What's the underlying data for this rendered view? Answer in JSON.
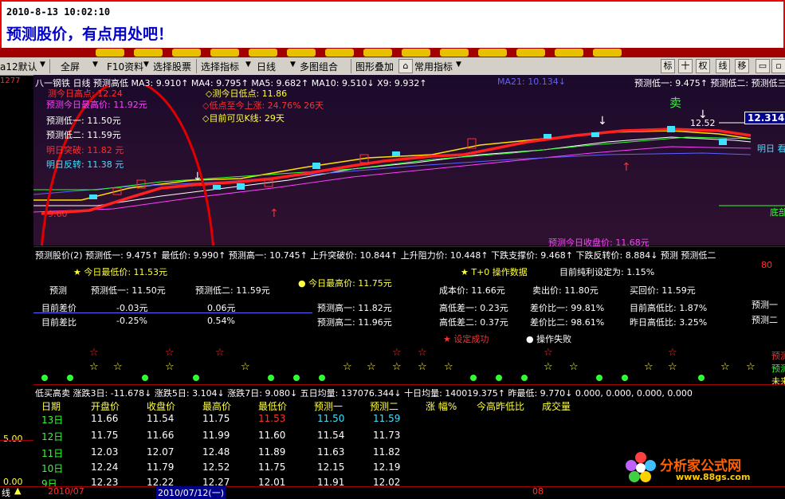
{
  "banner": {
    "timestamp": "2010-8-13 10:02:10",
    "title": "预测股价，有点用处吧！"
  },
  "toolbar": {
    "left_label": "a12默认",
    "items": [
      "全屏",
      "F10资料",
      "选择股票",
      "选择指标",
      "日线",
      "多图组合",
      "图形叠加",
      "常用指标"
    ],
    "right_icons": [
      "标",
      "十",
      "权",
      "线",
      "移"
    ]
  },
  "chart1": {
    "header": "八一钢铁 日线 预测高低 MA3: 9.910↑ MA4: 9.795↑ MA5: 9.682↑ MA10: 9.510↓ X9: 9.932↑",
    "header_ma21": "MA21: 10.134↓",
    "header_right": "预测低一: 9.475↑ 预测低二: 预测低三",
    "left_axis_top": "1277",
    "legend": [
      {
        "text": "测今日高点: 12.24",
        "color": "#ff3030"
      },
      {
        "text": "预测今日最高价: 11.92元",
        "color": "#ff40ff"
      },
      {
        "text": "预测低一: 11.50元",
        "color": "#ffffff"
      },
      {
        "text": "预测低二: 11.59元",
        "color": "#ffffff"
      },
      {
        "text": "明日突破: 11.82 元",
        "color": "#ff3030"
      },
      {
        "text": "明日反转: 11.38 元",
        "color": "#40e0ff"
      }
    ],
    "notes": [
      "◇测今日低点: 11.86",
      "◇低点至今上涨: 24.76%  26天",
      "◇目前可见K线: 29天"
    ],
    "sell_label": "卖",
    "price_marker": "12.52",
    "price_box": "12.314",
    "mingri_label": "明日 看",
    "dibu_label": "底部",
    "low_label": "9.60",
    "bottom_note": "预测今日收盘价: 11.68元"
  },
  "panel2": {
    "header": "预测股价(2) 预测低一: 9.475↑ 最低价: 9.990↑ 预测高一: 10.745↑ 上升突破价: 10.844↑ 上升阻力价: 10.448↑ 下跌支撑价: 9.468↑ 下跌反转价: 8.884↓ 预测 预测低二",
    "right_num": "80",
    "row1": [
      "★ 今日最低价: 11.53元",
      "● 今日最高价: 11.75元",
      "★ T+0 操作数据",
      "目前纯利设定为: 1.15%"
    ],
    "row2": [
      "预测",
      "预测低一: 11.50元",
      "预测低二: 11.59元",
      "成本价: 11.66元",
      "卖出价: 11.80元",
      "买回价: 11.59元"
    ],
    "row3": [
      "目前差价",
      "-0.03元",
      "0.06元",
      "预测高一: 11.82元",
      "高低差一: 0.23元",
      "差价比一: 99.81%",
      "目前高低比: 1.87%",
      "预测一"
    ],
    "row4": [
      "目前差比",
      "-0.25%",
      "0.54%",
      "预测高二: 11.96元",
      "高低差二: 0.37元",
      "差价比二: 98.61%",
      "昨日高低比: 3.25%",
      "预测二"
    ],
    "row5": [
      "★ 设定成功",
      "● 操作失败"
    ],
    "right_labels": [
      "预测",
      "预测",
      "未来"
    ],
    "status_line": "低买高卖 涨跌3日: -11.678↓ 涨跌5日: 3.104↓ 涨跌7日: 9.080↓ 五日均量: 137076.344↓ 十日均量: 140019.375↑ 昨最低: 9.770↓ 0.000, 0.000, 0.000, 0.000"
  },
  "table": {
    "headers": [
      "日期",
      "开盘价",
      "收盘价",
      "最高价",
      "最低价",
      "预测一",
      "预测二",
      "涨 幅%",
      "今高昨低比",
      "成交量"
    ],
    "rows": [
      [
        "13日",
        "11.66",
        "11.54",
        "11.75",
        "11.53",
        "11.50",
        "11.59"
      ],
      [
        "12日",
        "11.75",
        "11.66",
        "11.99",
        "11.60",
        "11.54",
        "11.73"
      ],
      [
        "11日",
        "12.03",
        "12.07",
        "12.48",
        "11.89",
        "11.63",
        "11.82"
      ],
      [
        "10日",
        "12.24",
        "11.79",
        "12.52",
        "11.75",
        "12.15",
        "12.19"
      ],
      [
        "9日",
        "12.23",
        "12.22",
        "12.27",
        "12.01",
        "11.91",
        "12.02"
      ]
    ],
    "left_axis": [
      "5.00",
      "0.00"
    ]
  },
  "bottom": {
    "left": "线",
    "date1": "2010/07",
    "date2": "2010/07/12(一)",
    "date3": "08"
  },
  "watermark": {
    "title": "分析家公式网",
    "url": "www.88gs.com"
  },
  "colors": {
    "banner_border": "#e00000",
    "menu": "#a00000",
    "ellipse": "#e00000"
  }
}
